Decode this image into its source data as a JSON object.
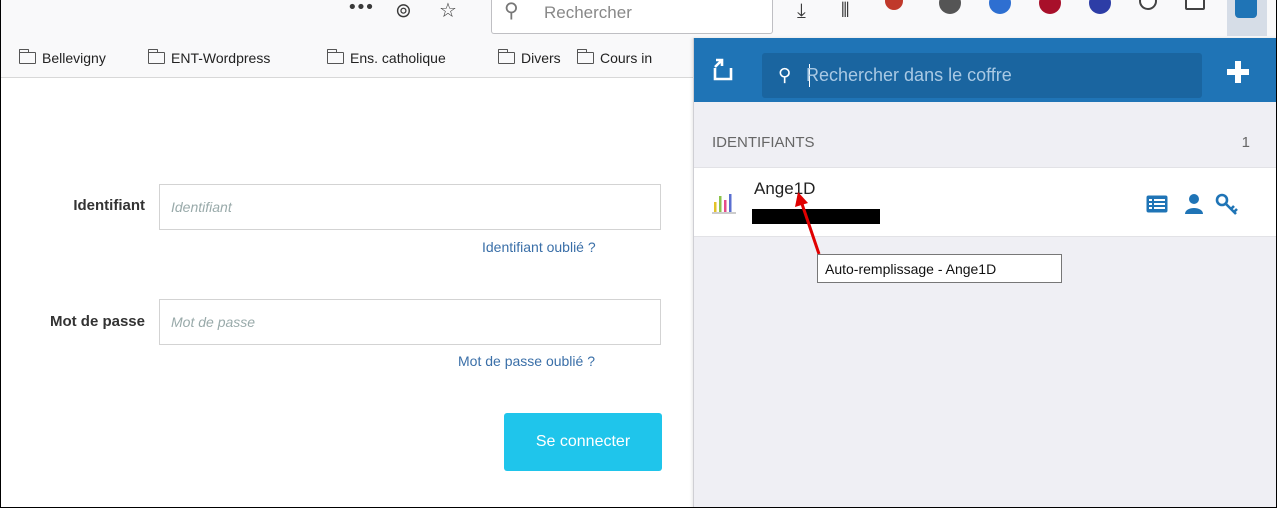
{
  "toolbar": {
    "search_placeholder": "Rechercher",
    "more_glyph": "•••",
    "pocket_glyph": "⊚",
    "star_glyph": "☆",
    "download_glyph": "⤓",
    "library_glyph": "⫴",
    "search_icon": "⚲"
  },
  "bookmarks": [
    {
      "label": "Bellevigny"
    },
    {
      "label": "ENT-Wordpress"
    },
    {
      "label": "Ens. catholique"
    },
    {
      "label": "Divers"
    },
    {
      "label": "Cours in"
    }
  ],
  "login": {
    "username_label": "Identifiant",
    "username_placeholder": "Identifiant",
    "username_forgot": "Identifiant oublié ?",
    "password_label": "Mot de passe",
    "password_placeholder": "Mot de passe",
    "password_forgot": "Mot de passe oublié ?",
    "submit_label": "Se connecter",
    "accent_color": "#1fc5eb",
    "link_color": "#3a6fa8"
  },
  "popup": {
    "header_color": "#1f74b6",
    "search_placeholder": "Rechercher dans le coffre",
    "search_icon": "⚲",
    "section_title": "IDENTIFIANTS",
    "section_count": "1",
    "cipher": {
      "name": "Ange1D",
      "tooltip": "Auto-remplissage - Ange1D"
    }
  },
  "annotation_color": "#e00000"
}
